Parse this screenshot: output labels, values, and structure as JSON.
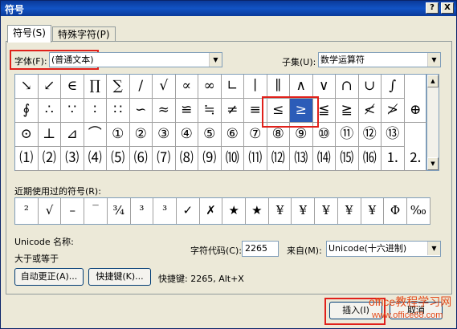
{
  "window": {
    "title": "符号",
    "help_button": "?",
    "close_button": "X"
  },
  "tabs": [
    {
      "label": "符号(S)"
    },
    {
      "label": "特殊字符(P)"
    }
  ],
  "font": {
    "label": "字体(F):",
    "value": "(普通文本)"
  },
  "subset": {
    "label": "子集(U):",
    "value": "数学运算符"
  },
  "symbol_grid": [
    [
      "↘",
      "↙",
      "∈",
      "∏",
      "∑",
      "∕",
      "√",
      "∝",
      "∞",
      "∟",
      "∣",
      "∥",
      "∧",
      "∨",
      "∩",
      "∪",
      "∫"
    ],
    [
      "∮",
      "∴",
      "∵",
      "∶",
      "∷",
      "∽",
      "≈",
      "≌",
      "≒",
      "≠",
      "≡",
      "≤",
      "≥",
      "≦",
      "≧",
      "≮",
      "≯",
      "⊕"
    ],
    [
      "⊙",
      "⊥",
      "⊿",
      "⌒",
      "①",
      "②",
      "③",
      "④",
      "⑤",
      "⑥",
      "⑦",
      "⑧",
      "⑨",
      "⑩",
      "⑪",
      "⑫",
      "⑬"
    ],
    [
      "⑴",
      "⑵",
      "⑶",
      "⑷",
      "⑸",
      "⑹",
      "⑺",
      "⑻",
      "⑼",
      "⑽",
      "⑾",
      "⑿",
      "⒀",
      "⒁",
      "⒂",
      "⒃",
      "⒈",
      "⒉"
    ]
  ],
  "selected_symbol": "≥",
  "recent": {
    "label": "近期使用过的符号(R):",
    "items": [
      "²",
      "√",
      "–",
      "‾",
      "¾",
      "³",
      "³",
      "✓",
      "✗",
      "★",
      "★",
      "¥",
      "¥",
      "¥",
      "¥",
      "¥",
      "Φ",
      "‰"
    ]
  },
  "unicode_name": {
    "label": "Unicode 名称:",
    "value": "大于或等于"
  },
  "char_code": {
    "label": "字符代码(C):",
    "value": "2265"
  },
  "from": {
    "label": "来自(M):",
    "value": "Unicode(十六进制)"
  },
  "buttons": {
    "autocorrect": "自动更正(A)...",
    "shortcut_key": "快捷键(K)...",
    "insert": "插入(I)",
    "cancel": "取消"
  },
  "shortcut_text": "快捷键: 2265, Alt+X",
  "watermark": {
    "line1": "office教程学习网",
    "line2": "www.office68.com"
  }
}
